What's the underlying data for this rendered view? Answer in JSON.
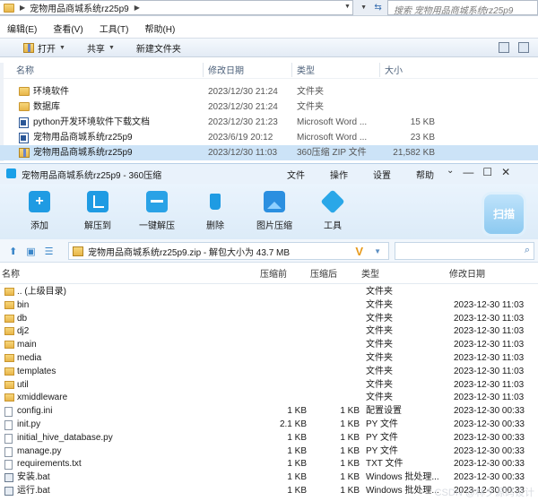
{
  "explorer": {
    "breadcrumb": "宠物用品商城系统rz25p9",
    "breadcrumb_sep": "▶",
    "search_placeholder": "搜索 宠物用品商城系统rz25p9",
    "menu": [
      "编辑(E)",
      "查看(V)",
      "工具(T)",
      "帮助(H)"
    ],
    "toolbar": {
      "open": "打开",
      "share": "共享",
      "new_folder": "新建文件夹"
    },
    "columns": {
      "name": "名称",
      "date": "修改日期",
      "type": "类型",
      "size": "大小"
    },
    "rows": [
      {
        "name": "环境软件",
        "date": "2023/12/30 21:24",
        "type": "文件夹",
        "size": "",
        "icon": "folder-icon"
      },
      {
        "name": "数据库",
        "date": "2023/12/30 21:24",
        "type": "文件夹",
        "size": "",
        "icon": "folder-icon"
      },
      {
        "name": "python开发环境软件下载文档",
        "date": "2023/12/30 21:23",
        "type": "Microsoft Word ...",
        "size": "15 KB",
        "icon": "word-doc-icon"
      },
      {
        "name": "宠物用品商城系统rz25p9",
        "date": "2023/6/19 20:12",
        "type": "Microsoft Word ...",
        "size": "23 KB",
        "icon": "word-doc-icon"
      },
      {
        "name": "宠物用品商城系统rz25p9",
        "date": "2023/12/30 11:03",
        "type": "360压缩 ZIP 文件",
        "size": "21,582 KB",
        "icon": "zip-icon",
        "selected": true
      }
    ]
  },
  "zip": {
    "title": "宠物用品商城系统rz25p9 - 360压缩",
    "menu": [
      "文件",
      "操作",
      "设置",
      "帮助"
    ],
    "tools": [
      {
        "label": "添加",
        "icon": "add-icon"
      },
      {
        "label": "解压到",
        "icon": "extract-icon"
      },
      {
        "label": "一键解压",
        "icon": "one-click-extract-icon"
      },
      {
        "label": "删除",
        "icon": "delete-icon"
      },
      {
        "label": "图片压缩",
        "icon": "image-compress-icon"
      },
      {
        "label": "工具",
        "icon": "tools-icon"
      }
    ],
    "scan_label": "扫描",
    "path": "宠物用品商城系统rz25p9.zip - 解包大小为 43.7 MB",
    "columns": {
      "name": "名称",
      "compressed": "压缩前",
      "packed": "压缩后",
      "type": "类型",
      "date": "修改日期"
    },
    "rows": [
      {
        "name": ".. (上级目录)",
        "c": "",
        "p": "",
        "type": "文件夹",
        "date": "",
        "icon": "folder"
      },
      {
        "name": "bin",
        "c": "",
        "p": "",
        "type": "文件夹",
        "date": "2023-12-30 11:03",
        "icon": "folder"
      },
      {
        "name": "db",
        "c": "",
        "p": "",
        "type": "文件夹",
        "date": "2023-12-30 11:03",
        "icon": "folder"
      },
      {
        "name": "dj2",
        "c": "",
        "p": "",
        "type": "文件夹",
        "date": "2023-12-30 11:03",
        "icon": "folder"
      },
      {
        "name": "main",
        "c": "",
        "p": "",
        "type": "文件夹",
        "date": "2023-12-30 11:03",
        "icon": "folder"
      },
      {
        "name": "media",
        "c": "",
        "p": "",
        "type": "文件夹",
        "date": "2023-12-30 11:03",
        "icon": "folder"
      },
      {
        "name": "templates",
        "c": "",
        "p": "",
        "type": "文件夹",
        "date": "2023-12-30 11:03",
        "icon": "folder"
      },
      {
        "name": "util",
        "c": "",
        "p": "",
        "type": "文件夹",
        "date": "2023-12-30 11:03",
        "icon": "folder"
      },
      {
        "name": "xmiddleware",
        "c": "",
        "p": "",
        "type": "文件夹",
        "date": "2023-12-30 11:03",
        "icon": "folder"
      },
      {
        "name": "config.ini",
        "c": "1 KB",
        "p": "1 KB",
        "type": "配置设置",
        "date": "2023-12-30 00:33",
        "icon": "file"
      },
      {
        "name": "init.py",
        "c": "2.1 KB",
        "p": "1 KB",
        "type": "PY 文件",
        "date": "2023-12-30 00:33",
        "icon": "file"
      },
      {
        "name": "initial_hive_database.py",
        "c": "1 KB",
        "p": "1 KB",
        "type": "PY 文件",
        "date": "2023-12-30 00:33",
        "icon": "file"
      },
      {
        "name": "manage.py",
        "c": "1 KB",
        "p": "1 KB",
        "type": "PY 文件",
        "date": "2023-12-30 00:33",
        "icon": "file"
      },
      {
        "name": "requirements.txt",
        "c": "1 KB",
        "p": "1 KB",
        "type": "TXT 文件",
        "date": "2023-12-30 00:33",
        "icon": "file"
      },
      {
        "name": "安装.bat",
        "c": "1 KB",
        "p": "1 KB",
        "type": "Windows 批处理...",
        "date": "2023-12-30 00:33",
        "icon": "bat"
      },
      {
        "name": "运行.bat",
        "c": "1 KB",
        "p": "1 KB",
        "type": "Windows 批处理...",
        "date": "2023-12-30 00:33",
        "icon": "bat"
      }
    ]
  },
  "watermark": "CSDN @林夕源码设计"
}
